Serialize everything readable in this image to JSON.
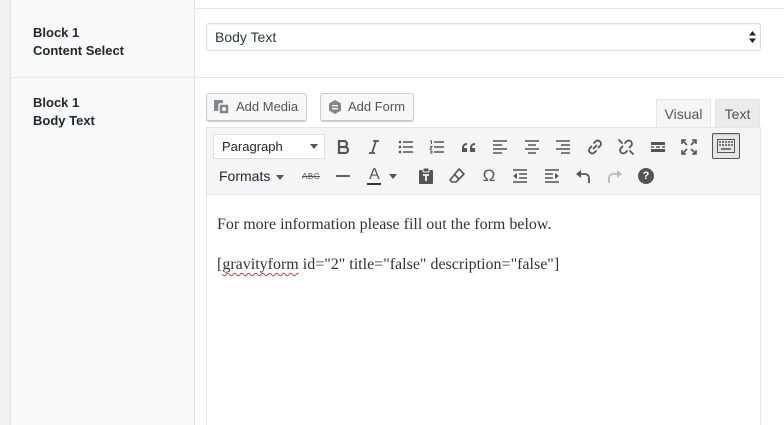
{
  "fields": {
    "content_select": {
      "label_line1": "Block 1",
      "label_line2": "Content Select",
      "value": "Body Text"
    },
    "body_text": {
      "label_line1": "Block 1",
      "label_line2": "Body Text"
    }
  },
  "media_buttons": {
    "add_media": "Add Media",
    "add_form": "Add Form"
  },
  "editor_tabs": {
    "visual": "Visual",
    "text": "Text",
    "active": "visual"
  },
  "toolbar": {
    "row1": {
      "format_select": "Paragraph",
      "buttons": [
        "bold-icon",
        "italic-icon",
        "bullet-list-icon",
        "numbered-list-icon",
        "blockquote-icon",
        "align-left-icon",
        "align-center-icon",
        "align-right-icon",
        "link-icon",
        "unlink-icon",
        "read-more-icon",
        "fullscreen-icon",
        "toolbar-toggle-icon"
      ]
    },
    "row2": {
      "formats_label": "Formats",
      "strikethrough_glyph": "ABC",
      "text_color_glyph": "A",
      "special_char_glyph": "Ω",
      "help_glyph": "?",
      "buttons": [
        "strikethrough-icon",
        "horizontal-line-icon",
        "text-color-icon",
        "paste-as-text-icon",
        "clear-formatting-icon",
        "special-character-icon",
        "outdent-icon",
        "indent-icon",
        "undo-icon",
        "redo-icon",
        "help-icon"
      ]
    }
  },
  "editor_content": {
    "paragraph1": "For more information please fill out the form below.",
    "shortcode_open": "[",
    "shortcode_tag": "gravityform",
    "shortcode_rest": " id=\"2\" title=\"false\" description=\"false\"]"
  },
  "colors": {
    "label_column_bg": "#f9f9f9",
    "toolbar_bg": "#f5f5f5",
    "spellcheck_underline": "#dc3232"
  }
}
